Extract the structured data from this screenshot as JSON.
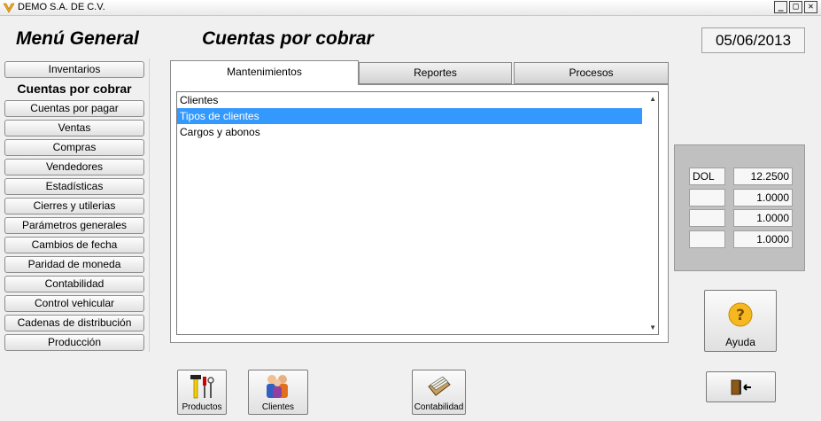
{
  "window": {
    "title": "DEMO  S.A. DE C.V."
  },
  "header": {
    "menu_title": "Menú General",
    "section_title": "Cuentas por cobrar",
    "date": "05/06/2013"
  },
  "sidebar": {
    "items": [
      {
        "label": "Inventarios"
      },
      {
        "label": "Cuentas por cobrar"
      },
      {
        "label": "Cuentas por pagar"
      },
      {
        "label": "Ventas"
      },
      {
        "label": "Compras"
      },
      {
        "label": "Vendedores"
      },
      {
        "label": "Estadísticas"
      },
      {
        "label": "Cierres y utilerias"
      },
      {
        "label": "Parámetros generales"
      },
      {
        "label": "Cambios de fecha"
      },
      {
        "label": "Paridad de moneda"
      },
      {
        "label": "Contabilidad"
      },
      {
        "label": "Control vehicular"
      },
      {
        "label": "Cadenas de distribución"
      },
      {
        "label": "Producción"
      }
    ]
  },
  "tabs": [
    {
      "label": "Mantenimientos"
    },
    {
      "label": "Reportes"
    },
    {
      "label": "Procesos"
    }
  ],
  "list": {
    "items": [
      {
        "label": "Clientes"
      },
      {
        "label": "Tipos de clientes"
      },
      {
        "label": "Cargos y abonos"
      }
    ]
  },
  "currency_rates": [
    {
      "code": "DOL",
      "value": "12.2500"
    },
    {
      "code": "",
      "value": "1.0000"
    },
    {
      "code": "",
      "value": "1.0000"
    },
    {
      "code": "",
      "value": "1.0000"
    }
  ],
  "buttons": {
    "productos": "Productos",
    "clientes": "Clientes",
    "contabilidad": "Contabilidad",
    "ayuda": "Ayuda"
  },
  "colors": {
    "selection": "#3399ff",
    "rate_panel": "#c0c0c0"
  }
}
